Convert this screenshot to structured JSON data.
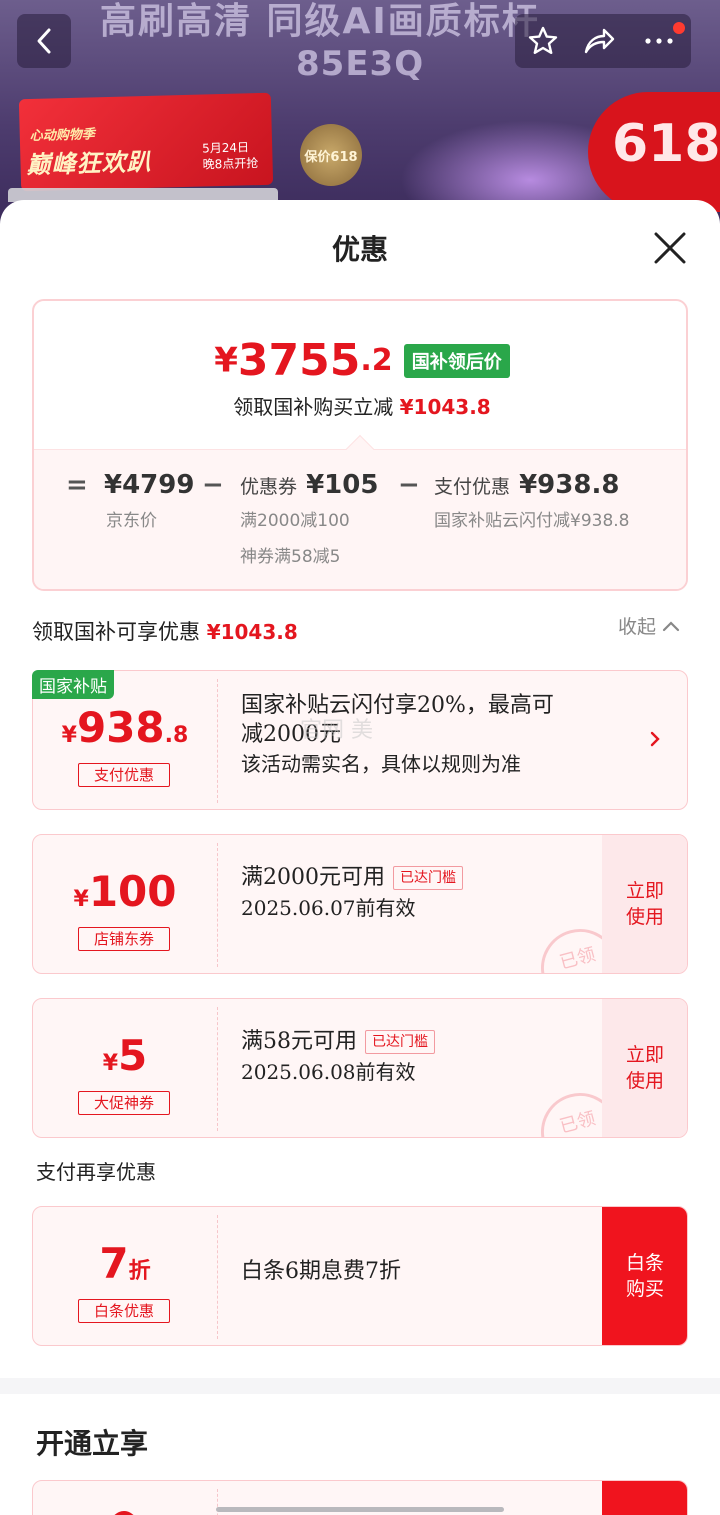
{
  "background": {
    "headline": "高刷高清 同级AI画质标杆",
    "model": "85E3Q",
    "promo_small": "心动购物季",
    "promo_big": "巅峰狂欢趴",
    "promo_date_1": "5月24日",
    "promo_date_2": "晚8点开抢",
    "seal_text": "保价618",
    "badge": "618"
  },
  "sheet": {
    "title": "优惠"
  },
  "summary": {
    "currency": "¥",
    "price_int": "3755",
    "price_dec": ".2",
    "price_tag": "国补领后价",
    "sub_text": "领取国补购买立减",
    "sub_amount": "¥1043.8",
    "op_equal": "=",
    "op_minus": "−",
    "items": [
      {
        "label": "",
        "value": "¥4799",
        "notes": [
          "京东价"
        ]
      },
      {
        "label": "优惠券",
        "value": "¥105",
        "notes": [
          "满2000减100",
          "神券满58减5"
        ]
      },
      {
        "label": "支付优惠",
        "value": "¥938.8",
        "notes": [
          "国家补贴云闪付减¥938.8"
        ]
      }
    ]
  },
  "section": {
    "title": "领取国补可享优惠",
    "amount": "¥1043.8",
    "collapse": "收起"
  },
  "coupons": [
    {
      "badge": "国家补贴",
      "currency": "¥",
      "amount": "938",
      "decimal": ".8",
      "tag": "支付优惠",
      "line1": "国家补贴云闪付享20%，最高可",
      "line2": "减2000元",
      "line3": "该活动需实名，具体以规则为准",
      "watermark": "官网 美"
    },
    {
      "currency": "¥",
      "amount": "100",
      "tag": "店铺东券",
      "line1": "满2000元可用",
      "reached": "已达门槛",
      "line2": "2025.06.07前有效",
      "action": [
        "立即",
        "使用"
      ],
      "stamp": "已领"
    },
    {
      "currency": "¥",
      "amount": "5",
      "tag": "大促神券",
      "line1": "满58元可用",
      "reached": "已达门槛",
      "line2": "2025.06.08前有效",
      "action": [
        "立即",
        "使用"
      ],
      "stamp": "已领"
    }
  ],
  "pay": {
    "title": "支付再享优惠",
    "amount": "7",
    "unit": "折",
    "tag": "白条优惠",
    "text": "白条6期息费7折",
    "action": [
      "白条",
      "购买"
    ]
  },
  "open": {
    "title": "开通立享"
  },
  "colors": {
    "accent_red": "#e4161f",
    "green": "#2aa74a",
    "pink_border": "#fbc9cd",
    "card_bg": "#fff6f6"
  }
}
